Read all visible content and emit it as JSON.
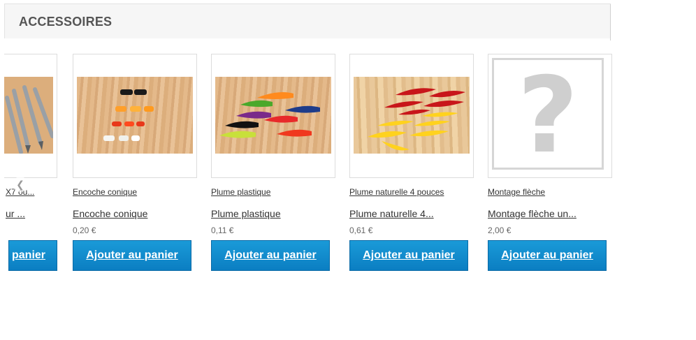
{
  "section": {
    "title": "ACCESSOIRES"
  },
  "products": [
    {
      "category": "X7 ou...",
      "name": "ur ...",
      "price": "",
      "button": "panier",
      "image": "arrow-tips-photo"
    },
    {
      "category": "Encoche conique",
      "name": "Encoche conique",
      "price": "0,20 €",
      "button": "Ajouter au panier",
      "image": "nocks-photo"
    },
    {
      "category": "Plume plastique",
      "name": "Plume plastique",
      "price": "0,11 €",
      "button": "Ajouter au panier",
      "image": "plastic-vanes-photo"
    },
    {
      "category": "Plume naturelle 4 pouces",
      "name": "Plume naturelle 4...",
      "price": "0,61 €",
      "button": "Ajouter au panier",
      "image": "natural-feathers-photo"
    },
    {
      "category": "Montage flèche",
      "name": "Montage flèche un...",
      "price": "2,00 €",
      "button": "Ajouter au panier",
      "image": "no-image-placeholder"
    }
  ],
  "carousel": {
    "prev_icon": "chevron-left-icon"
  },
  "colors": {
    "button": "#0b7ec2",
    "header_bg": "#f6f6f6"
  }
}
